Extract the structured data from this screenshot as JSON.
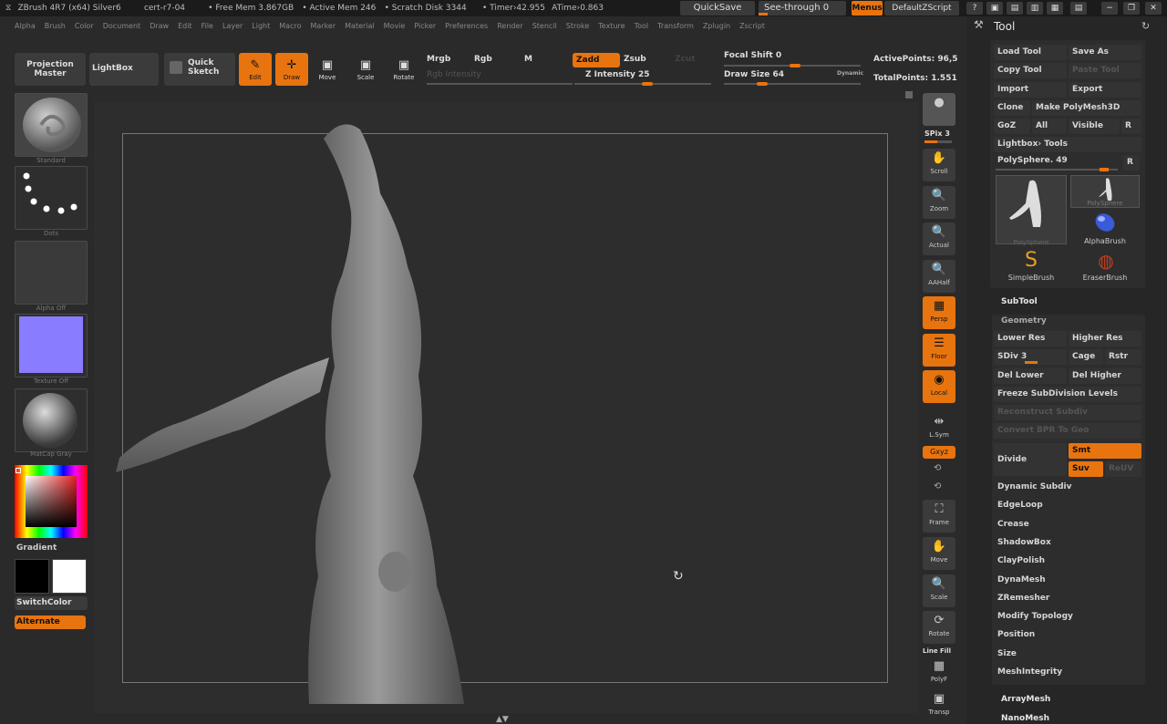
{
  "titlebar": {
    "app": "ZBrush 4R7 (x64) Silver6",
    "cert": "cert-r7-04",
    "free_mem": "• Free Mem 3.867GB",
    "active_mem": "• Active Mem 246",
    "scratch": "• Scratch Disk 3344",
    "timer": "• Timer›42.955",
    "atime": "ATime›0.863",
    "quicksave": "QuickSave",
    "see_through": "See-through  0",
    "menus": "Menus",
    "default_zscript": "DefaultZScript"
  },
  "menubar": [
    "Alpha",
    "Brush",
    "Color",
    "Document",
    "Draw",
    "Edit",
    "File",
    "Layer",
    "Light",
    "Macro",
    "Marker",
    "Material",
    "Movie",
    "Picker",
    "Preferences",
    "Render",
    "Stencil",
    "Stroke",
    "Texture",
    "Tool",
    "Transform",
    "Zplugin",
    "Zscript"
  ],
  "toolbar": {
    "projection_master": "Projection Master",
    "lightbox": "LightBox",
    "quick_sketch": "Quick Sketch",
    "edit": "Edit",
    "draw": "Draw",
    "move": "Move",
    "scale": "Scale",
    "rotate": "Rotate",
    "mrgb": "Mrgb",
    "rgb": "Rgb",
    "m": "M",
    "rgb_intensity": "Rgb Intensity",
    "zadd": "Zadd",
    "zsub": "Zsub",
    "zcut": "Zcut",
    "z_intensity": "Z Intensity 25",
    "focal_shift": "Focal Shift 0",
    "draw_size": "Draw Size 64",
    "dynamic": "Dynamic",
    "active_points": "ActivePoints: 96,5",
    "total_points": "TotalPoints: 1.551",
    "z_intensity_value": 25,
    "draw_size_value": 64
  },
  "leftshelf": {
    "brush": "Standard",
    "stroke": "Dots",
    "alpha": "Alpha Off",
    "texture": "Texture Off",
    "material": "MatCap Gray",
    "gradient": "Gradient",
    "switchcolor": "SwitchColor",
    "alternate": "Alternate"
  },
  "rightshelf": {
    "bpr": "BPR",
    "spix": "SPix 3",
    "scroll": "Scroll",
    "zoom": "Zoom",
    "actual": "Actual",
    "aahalf": "AAHalf",
    "persp": "Persp",
    "floor": "Floor",
    "local": "Local",
    "lsym": "L.Sym",
    "xyz": "Gxyz",
    "frame": "Frame",
    "move": "Move",
    "scale": "Scale",
    "rotate": "Rotate",
    "linefill": "Line Fill",
    "polyf": "PolyF",
    "transp": "Transp"
  },
  "toolpanel": {
    "title": "Tool",
    "load_tool": "Load Tool",
    "save_as": "Save As",
    "copy_tool": "Copy Tool",
    "paste_tool": "Paste Tool",
    "import": "Import",
    "export": "Export",
    "clone": "Clone",
    "make_polymesh": "Make PolyMesh3D",
    "goz": "GoZ",
    "all": "All",
    "visible": "Visible",
    "r": "R",
    "lightbox_tools": "Lightbox› Tools",
    "polysphere": "PolySphere. 49",
    "thumbs": [
      "PolySphere",
      "PolySphere",
      "AlphaBrush",
      "SimpleBrush",
      "EraserBrush"
    ],
    "subtool": "SubTool",
    "geometry": "Geometry",
    "lower_res": "Lower Res",
    "higher_res": "Higher Res",
    "sdiv": "SDiv 3",
    "cage": "Cage",
    "rstr": "Rstr",
    "del_lower": "Del Lower",
    "del_higher": "Del Higher",
    "freeze": "Freeze SubDivision Levels",
    "reconstruct": "Reconstruct Subdiv",
    "convert_bpr": "Convert BPR To Geo",
    "divide": "Divide",
    "smt": "Smt",
    "suv": "Suv",
    "relax": "ReUV",
    "items": [
      "Dynamic Subdiv",
      "EdgeLoop",
      "Crease",
      "ShadowBox",
      "ClayPolish",
      "DynaMesh",
      "ZRemesher",
      "Modify Topology",
      "Position",
      "Size",
      "MeshIntegrity"
    ],
    "arraymesh": "ArrayMesh",
    "nanomesh": "NanoMesh"
  },
  "colors": {
    "accent": "#e8740f",
    "secondary_color": "#8a7cff"
  }
}
